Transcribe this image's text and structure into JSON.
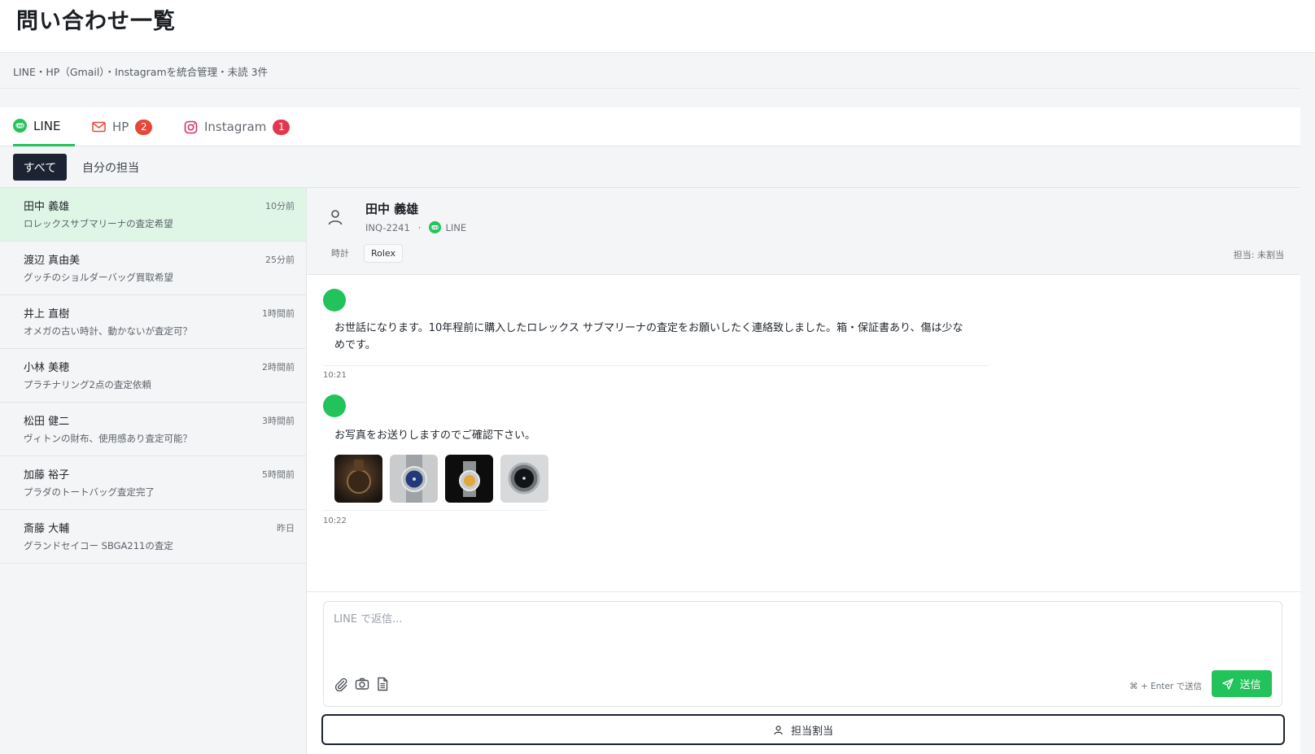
{
  "header": {
    "title": "問い合わせ一覧"
  },
  "subtitle": "LINE・HP（Gmail）・Instagramを統合管理・未読 3件",
  "tabs": [
    {
      "label": "LINE",
      "icon": "line-icon",
      "badge": ""
    },
    {
      "label": "HP",
      "icon": "mail-icon",
      "badge": "2"
    },
    {
      "label": "Instagram",
      "icon": "instagram-icon",
      "badge": "1"
    }
  ],
  "filters": {
    "all": "すべて",
    "mine": "自分の担当"
  },
  "inquiries": [
    {
      "name": "田中 義雄",
      "time": "10分前",
      "preview": "ロレックスサブマリーナの査定希望"
    },
    {
      "name": "渡辺 真由美",
      "time": "25分前",
      "preview": "グッチのショルダーバッグ買取希望"
    },
    {
      "name": "井上 直樹",
      "time": "1時間前",
      "preview": "オメガの古い時計、動かないが査定可？"
    },
    {
      "name": "小林 美穂",
      "time": "2時間前",
      "preview": "プラチナリング2点の査定依頼"
    },
    {
      "name": "松田 健二",
      "time": "3時間前",
      "preview": "ヴィトンの財布、使用感あり査定可能？"
    },
    {
      "name": "加藤 裕子",
      "time": "5時間前",
      "preview": "プラダのトートバッグ査定完了"
    },
    {
      "name": "斎藤 大輔",
      "time": "昨日",
      "preview": "グランドセイコー SBGA211の査定"
    }
  ],
  "detail": {
    "name": "田中 義雄",
    "id": "INQ-2241",
    "separator": "·",
    "channel": "LINE",
    "category": "時計",
    "tag": "Rolex",
    "assignee": "担当: 未割当",
    "messages": [
      {
        "text": "お世話になります。10年程前に購入したロレックス サブマリーナの査定をお願いしたく連絡致しました。箱・保証書あり、傷は少なめです。",
        "time": "10:21"
      },
      {
        "text": "お写真をお送りしますのでご確認下さい。",
        "time": "10:22"
      }
    ]
  },
  "composer": {
    "placeholder": "LINE で返信...",
    "hint": "⌘ + Enter で送信",
    "send_label": "送信",
    "assign_label": "担当割当"
  },
  "colors": {
    "accent": "#22c35a",
    "dark": "#1c2433",
    "badge": "#e2384f",
    "selected": "#dff6e6"
  }
}
